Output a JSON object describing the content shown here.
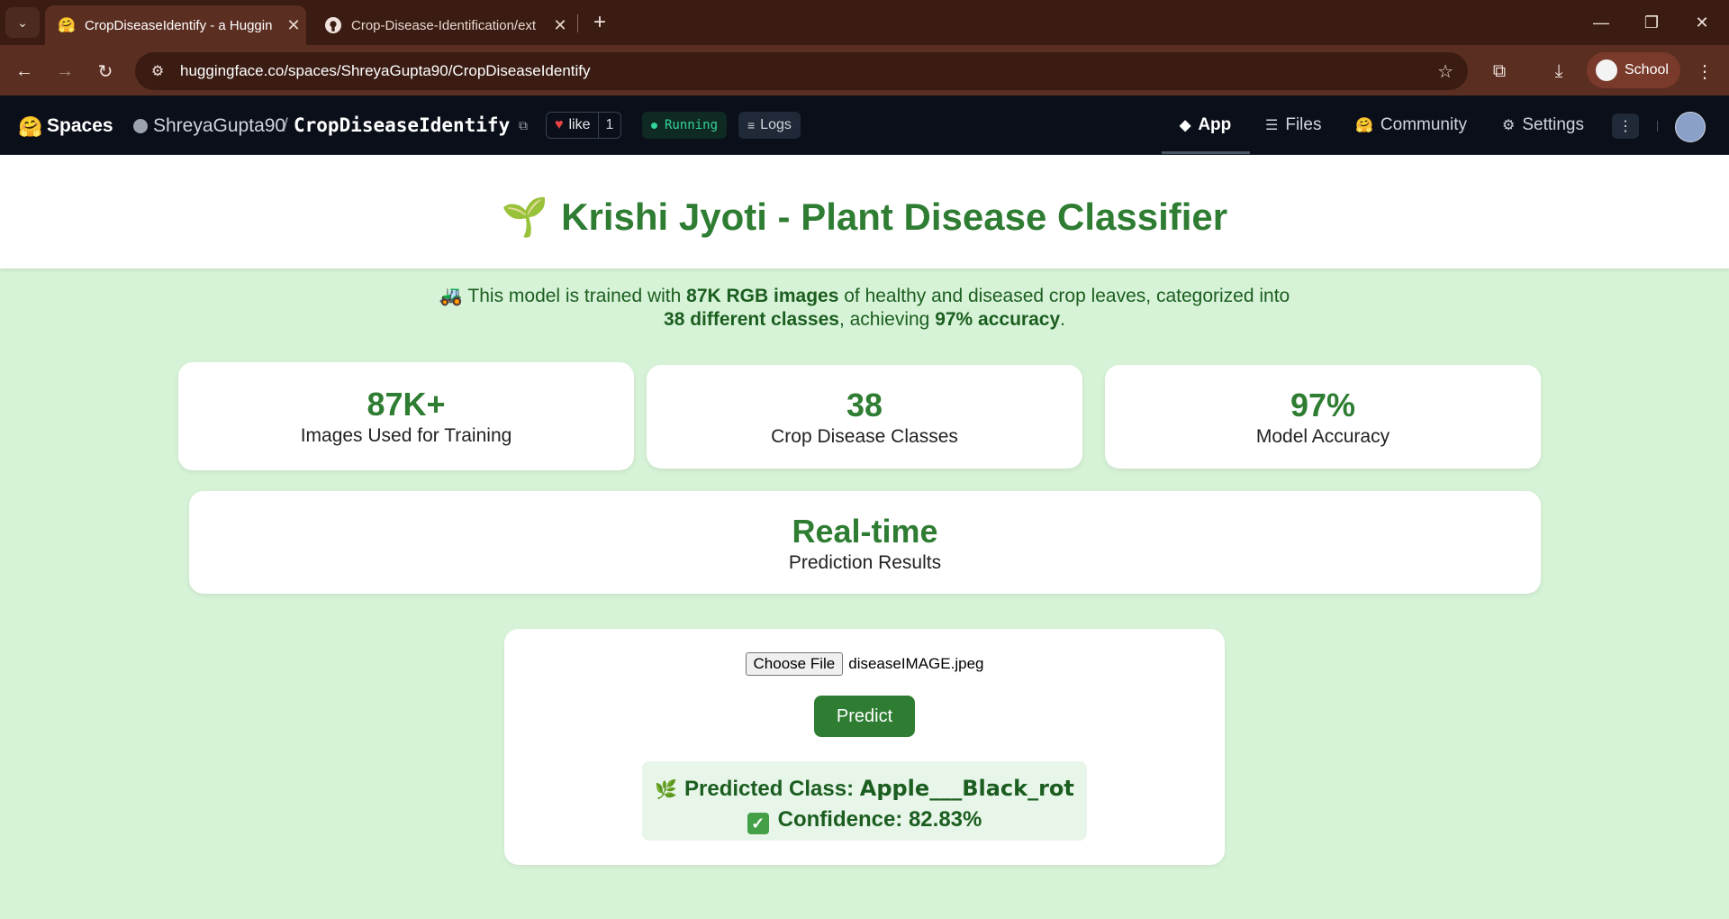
{
  "browser": {
    "tabs": [
      {
        "title": "CropDiseaseIdentify - a Huggin",
        "icon": "huggingface-icon",
        "active": true
      },
      {
        "title": "Crop-Disease-Identification/ext",
        "icon": "github-icon",
        "active": false
      }
    ],
    "url": "huggingface.co/spaces/ShreyaGupta90/CropDiseaseIdentify",
    "profile_label": "School",
    "colors": {
      "tabbar": "#3a1c13",
      "toolbar": "#5b2e22"
    }
  },
  "hf_header": {
    "brand": "Spaces",
    "owner": "ShreyaGupta90",
    "separator": "/",
    "repo": "CropDiseaseIdentify",
    "like_label": "like",
    "like_count": "1",
    "status": "Running",
    "logs_label": "Logs",
    "nav": {
      "app": "App",
      "files": "Files",
      "community": "Community",
      "settings": "Settings"
    },
    "more": "⋮"
  },
  "app": {
    "title": "Krishi Jyoti - Plant Disease Classifier",
    "title_icon": "🌱",
    "intro": {
      "icon": "🚜",
      "p1": "This model is trained with ",
      "b1": "87K RGB images",
      "p2": " of healthy and diseased crop leaves, categorized into",
      "b2": "38 different classes",
      "p3": ", achieving ",
      "b3": "97% accuracy",
      "p4": "."
    },
    "stats": [
      {
        "value": "87K+",
        "label": "Images Used for Training"
      },
      {
        "value": "38",
        "label": "Crop Disease Classes"
      },
      {
        "value": "97%",
        "label": "Model Accuracy"
      },
      {
        "value": "Real-time",
        "label": "Prediction Results"
      }
    ],
    "upload": {
      "choose_label": "Choose File",
      "filename": "diseaseIMAGE.jpeg",
      "predict_label": "Predict"
    },
    "result": {
      "class_icon": "🌿",
      "class_prefix": "Predicted Class:",
      "class_value": "Apple___Black_rot",
      "confidence_label": "Confidence: 82.83%"
    },
    "colors": {
      "accent": "#2e7d32",
      "background": "#d7f3d7",
      "result_bg": "#e8f5e9"
    }
  }
}
